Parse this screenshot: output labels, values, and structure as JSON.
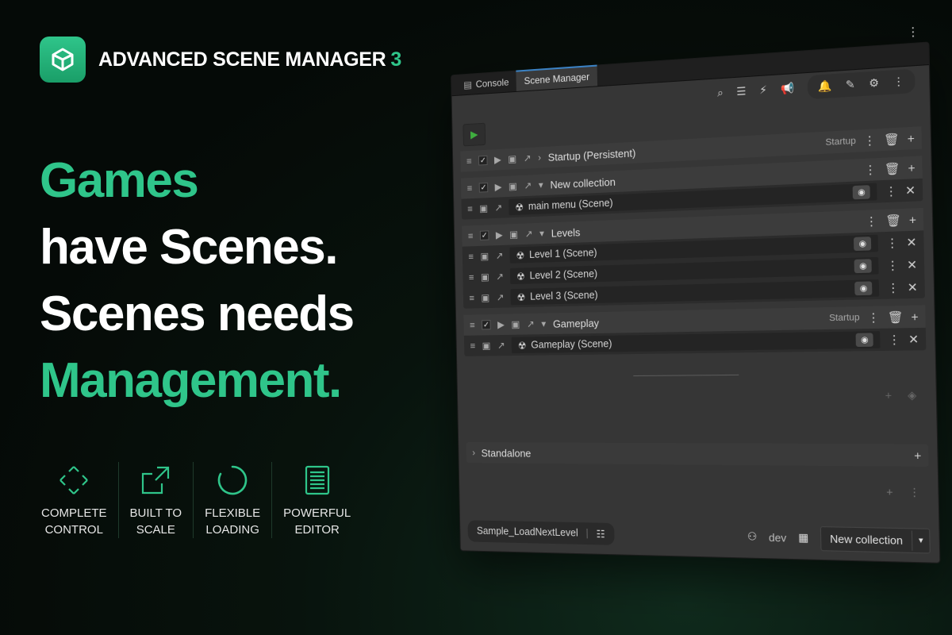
{
  "brand": {
    "name": "ADVANCED SCENE MANAGER",
    "version": "3",
    "logo_icon": "cube-icon"
  },
  "headline": {
    "line1": "Games",
    "line2": "have Scenes.",
    "line3": "Scenes needs",
    "line4": "Management."
  },
  "features": [
    {
      "icon": "diamond-arrows-icon",
      "label": "COMPLETE\nCONTROL"
    },
    {
      "icon": "scale-arrow-icon",
      "label": "BUILT TO\nSCALE"
    },
    {
      "icon": "loading-spinner-icon",
      "label": "FLEXIBLE\nLOADING"
    },
    {
      "icon": "document-list-icon",
      "label": "POWERFUL\nEDITOR"
    }
  ],
  "editor": {
    "tabs": {
      "console": "Console",
      "scene_manager": "Scene Manager"
    },
    "collections": {
      "startup": {
        "name": "Startup (Persistent)",
        "tag": "Startup"
      },
      "new_collection": {
        "name": "New collection",
        "scenes": [
          "main menu (Scene)"
        ]
      },
      "levels": {
        "name": "Levels",
        "scenes": [
          "Level 1 (Scene)",
          "Level 2 (Scene)",
          "Level 3 (Scene)"
        ]
      },
      "gameplay": {
        "name": "Gameplay",
        "tag": "Startup",
        "scenes": [
          "Gameplay (Scene)"
        ]
      }
    },
    "standalone": "Standalone",
    "footer": {
      "profile": "Sample_LoadNextLevel",
      "dev": "dev",
      "new_collection_button": "New collection"
    }
  },
  "colors": {
    "accent": "#2fc58a",
    "background": "#050a07",
    "panel": "#363636"
  }
}
